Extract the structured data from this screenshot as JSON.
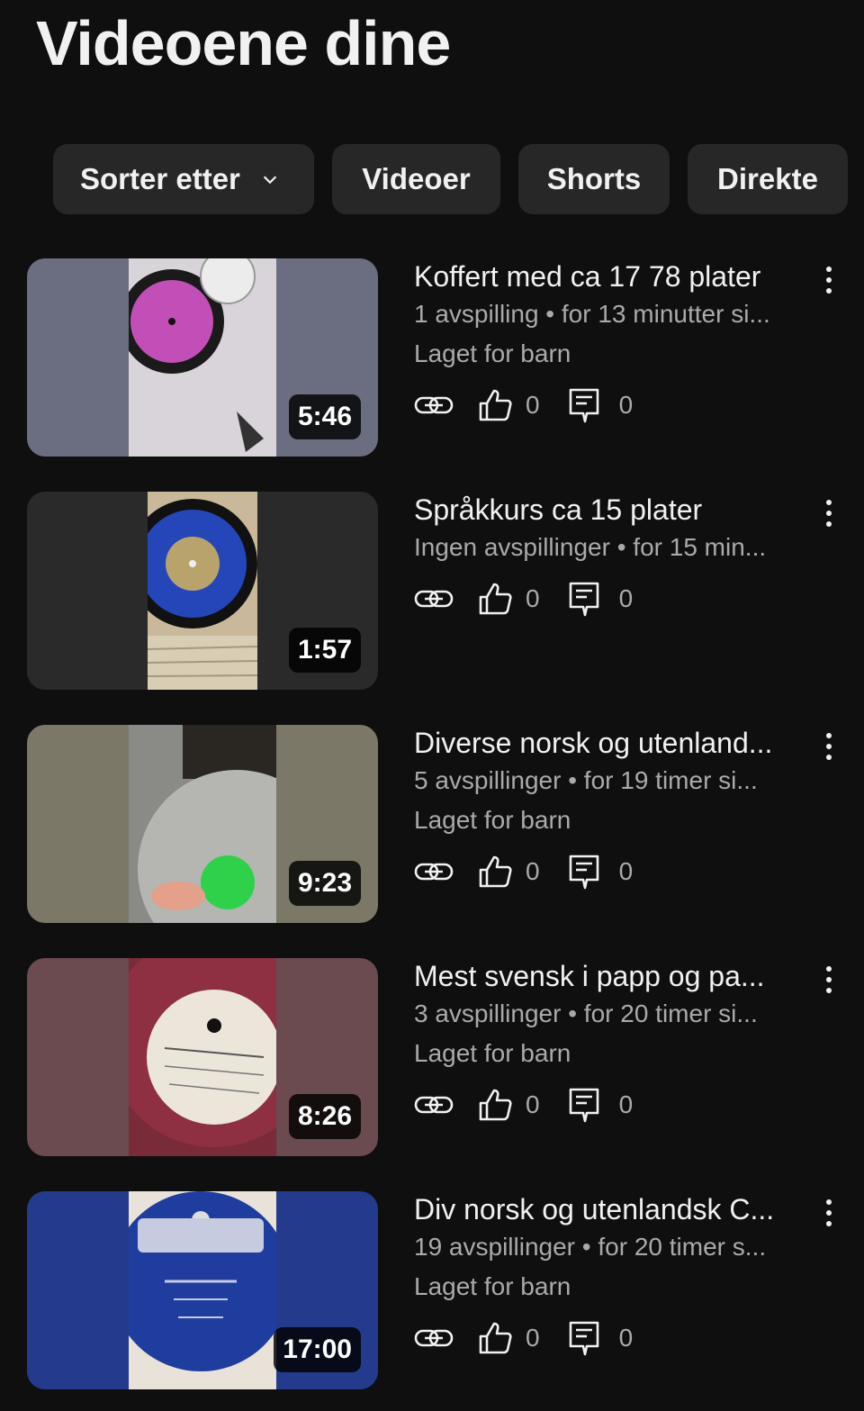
{
  "header": {
    "title": "Videoene dine"
  },
  "filters": {
    "sort_label": "Sorter etter",
    "chips": [
      "Videoer",
      "Shorts",
      "Direkte"
    ]
  },
  "videos": [
    {
      "title": "Koffert med ca 17 78 plater",
      "views": "1 avspilling",
      "age": "for 13 minutter si...",
      "kids": "Laget for barn",
      "duration": "5:46",
      "likes": "0",
      "comments": "0"
    },
    {
      "title": "Språkkurs ca 15 plater",
      "views": "Ingen avspillinger",
      "age": "for 15 min...",
      "kids": "",
      "duration": "1:57",
      "likes": "0",
      "comments": "0"
    },
    {
      "title": "Diverse norsk og utenland...",
      "views": "5 avspillinger",
      "age": "for 19 timer si...",
      "kids": "Laget for barn",
      "duration": "9:23",
      "likes": "0",
      "comments": "0"
    },
    {
      "title": "Mest svensk i papp og pa...",
      "views": "3 avspillinger",
      "age": "for 20 timer si...",
      "kids": "Laget for barn",
      "duration": "8:26",
      "likes": "0",
      "comments": "0"
    },
    {
      "title": "Div norsk og utenlandsk C...",
      "views": "19 avspillinger",
      "age": "for 20 timer s...",
      "kids": "Laget for barn",
      "duration": "17:00",
      "likes": "0",
      "comments": "0"
    }
  ],
  "colors": {
    "background": "#0f0f0f",
    "chip": "#272727",
    "secondary_text": "#aaaaaa",
    "thumb_bg": [
      "#6b6e80",
      "#2a2a2a",
      "#7c7868",
      "#6b4a50",
      "#243a8c"
    ]
  }
}
